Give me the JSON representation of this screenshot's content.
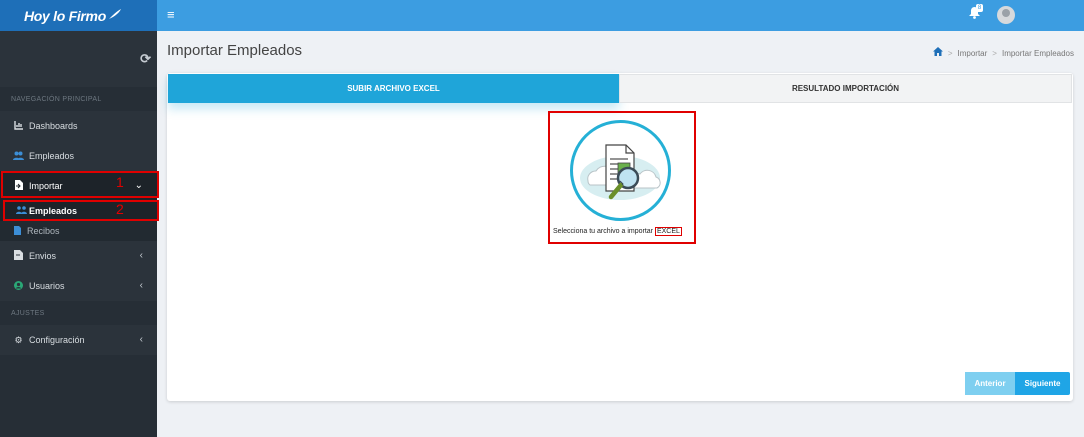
{
  "brand": {
    "name": "Hoy lo Firmo"
  },
  "topbar": {
    "menu_icon": "menu-icon",
    "notification_count": "8"
  },
  "sidebar": {
    "section_nav": "NAVEGACIÓN PRINCIPAL",
    "section_settings": "AJUSTES",
    "items": [
      {
        "label": "Dashboards",
        "icon": "chart-icon"
      },
      {
        "label": "Empleados",
        "icon": "users-icon"
      },
      {
        "label": "Importar",
        "icon": "import-icon"
      },
      {
        "label": "Envios",
        "icon": "send-icon"
      },
      {
        "label": "Usuarios",
        "icon": "user-icon"
      },
      {
        "label": "Configuración",
        "icon": "gear-icon"
      }
    ],
    "subitems": [
      {
        "label": "Empleados",
        "icon": "users-icon"
      },
      {
        "label": "Recibos",
        "icon": "file-icon"
      }
    ],
    "annotations": [
      "1",
      "2"
    ]
  },
  "page": {
    "title": "Importar Empleados",
    "breadcrumb": [
      "Importar",
      "Importar Empleados"
    ]
  },
  "tabs": [
    {
      "label": "SUBIR ARCHIVO EXCEL",
      "active": true
    },
    {
      "label": "RESULTADO IMPORTACIÓN",
      "active": false
    }
  ],
  "upload": {
    "caption": "Selecciona tu archivo a importar",
    "ext": "EXCEL"
  },
  "buttons": {
    "prev": "Anterior",
    "next": "Siguiente"
  },
  "colors": {
    "primary": "#1fa5d9",
    "sidebar": "#262e36",
    "topbar": "#3c9de1",
    "highlight": "#e00000"
  }
}
